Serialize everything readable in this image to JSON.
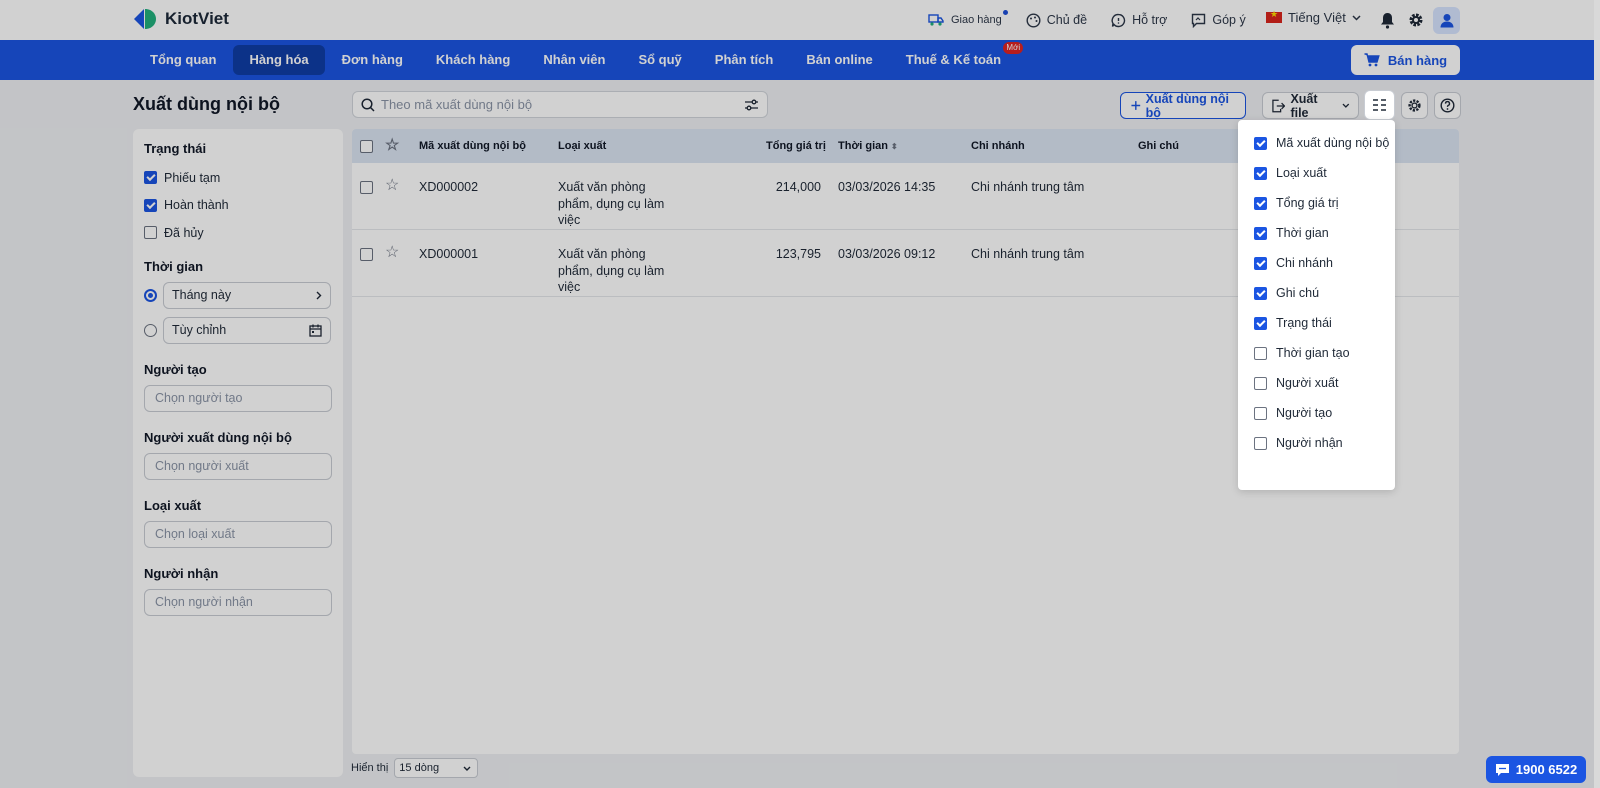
{
  "app": {
    "logo_text": "KiotViet"
  },
  "topbar": {
    "delivery_label": "Giao hàng",
    "theme_label": "Chủ đề",
    "support_label": "Hỗ trợ",
    "feedback_label": "Góp ý",
    "language_label": "Tiếng Việt"
  },
  "nav": {
    "items": [
      {
        "label": "Tổng quan"
      },
      {
        "label": "Hàng hóa"
      },
      {
        "label": "Đơn hàng"
      },
      {
        "label": "Khách hàng"
      },
      {
        "label": "Nhân viên"
      },
      {
        "label": "Sổ quỹ"
      },
      {
        "label": "Phân tích"
      },
      {
        "label": "Bán online"
      },
      {
        "label": "Thuế & Kế toán",
        "badge": "Mới"
      }
    ],
    "active_index": 1,
    "sell_button": "Bán hàng"
  },
  "page": {
    "title": "Xuất dùng nội bộ",
    "search_placeholder": "Theo mã xuất dùng nội bộ",
    "add_button": "Xuất dùng nội bộ",
    "export_button": "Xuất file"
  },
  "filters": {
    "status_title": "Trạng thái",
    "statuses": [
      {
        "label": "Phiếu tạm",
        "checked": true
      },
      {
        "label": "Hoàn thành",
        "checked": true
      },
      {
        "label": "Đã hủy",
        "checked": false
      }
    ],
    "time_title": "Thời gian",
    "time_preset": "Tháng này",
    "time_custom": "Tùy chỉnh",
    "creator_title": "Người tạo",
    "creator_placeholder": "Chọn người tạo",
    "exporter_title": "Người xuất dùng nội bộ",
    "exporter_placeholder": "Chọn người xuất",
    "type_title": "Loại xuất",
    "type_placeholder": "Chọn loại xuất",
    "receiver_title": "Người nhận",
    "receiver_placeholder": "Chọn người nhận"
  },
  "table": {
    "columns": [
      "Mã xuất dùng nội bộ",
      "Loại xuất",
      "Tổng giá trị",
      "Thời gian",
      "Chi nhánh",
      "Ghi chú"
    ],
    "rows": [
      {
        "code": "XD000002",
        "type_line1": "Xuất văn phòng",
        "type_line2": "phẩm, dụng cụ làm",
        "type_line3": "việc",
        "total": "214,000",
        "time": "03/03/2026 14:35",
        "branch": "Chi nhánh trung tâm",
        "note": ""
      },
      {
        "code": "XD000001",
        "type_line1": "Xuất văn phòng",
        "type_line2": "phẩm, dụng cụ làm",
        "type_line3": "việc",
        "total": "123,795",
        "time": "03/03/2026 09:12",
        "branch": "Chi nhánh trung tâm",
        "note": ""
      }
    ]
  },
  "footer": {
    "show_label": "Hiển thị",
    "page_size": "15 dòng"
  },
  "column_picker": {
    "options": [
      {
        "label": "Mã xuất dùng nội bộ",
        "checked": true
      },
      {
        "label": "Loại xuất",
        "checked": true
      },
      {
        "label": "Tổng giá trị",
        "checked": true
      },
      {
        "label": "Thời gian",
        "checked": true
      },
      {
        "label": "Chi nhánh",
        "checked": true
      },
      {
        "label": "Ghi chú",
        "checked": true
      },
      {
        "label": "Trạng thái",
        "checked": true
      },
      {
        "label": "Thời gian tạo",
        "checked": false
      },
      {
        "label": "Người xuất",
        "checked": false
      },
      {
        "label": "Người tạo",
        "checked": false
      },
      {
        "label": "Người nhận",
        "checked": false
      }
    ]
  },
  "hotline": {
    "label": "1900 6522"
  },
  "colors": {
    "primary": "#1b55e2",
    "nav_active": "#0f3ea6",
    "header_row": "#dbe4f2",
    "badge": "#e02424"
  }
}
